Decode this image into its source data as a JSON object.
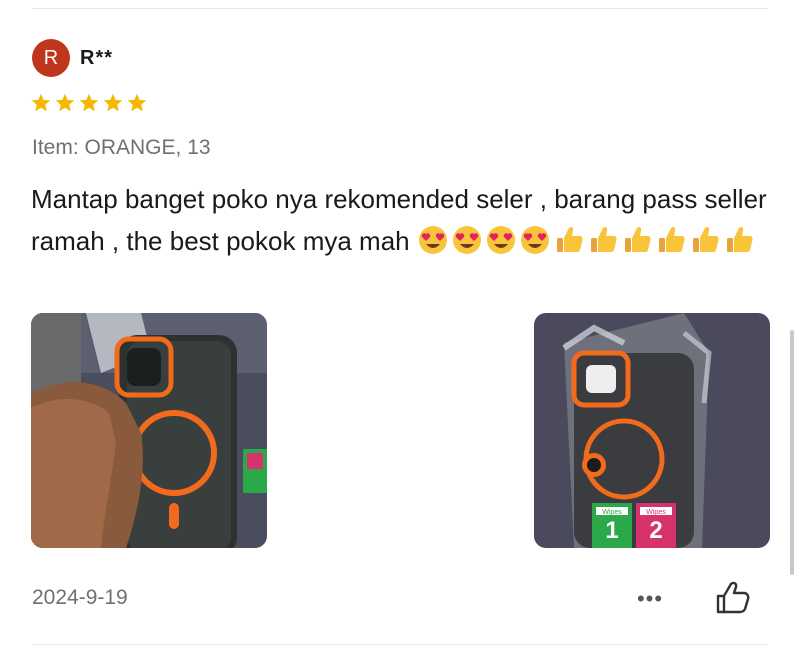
{
  "review": {
    "avatar_initial": "R",
    "username": "R**",
    "rating": 5,
    "item_line": "Item: ORANGE, 13",
    "text": "Mantap banget poko nya rekomended seler , barang pass seller ramah , the best pokok mya mah",
    "emojis": [
      "heart-eyes",
      "heart-eyes",
      "heart-eyes",
      "heart-eyes",
      "thumbs-up",
      "thumbs-up",
      "thumbs-up",
      "thumbs-up",
      "thumbs-up",
      "thumbs-up"
    ],
    "date": "2024-9-19",
    "more_label": "•••"
  },
  "photos": [
    {
      "name": "photo-phone-case-in-hand"
    },
    {
      "name": "photo-phone-case-in-package",
      "sticker_1": "1",
      "sticker_2": "2",
      "sticker_text": "Wipes"
    }
  ],
  "colors": {
    "avatar": "#c0361d",
    "star": "#f5b800",
    "accent_orange": "#f26a1b"
  }
}
